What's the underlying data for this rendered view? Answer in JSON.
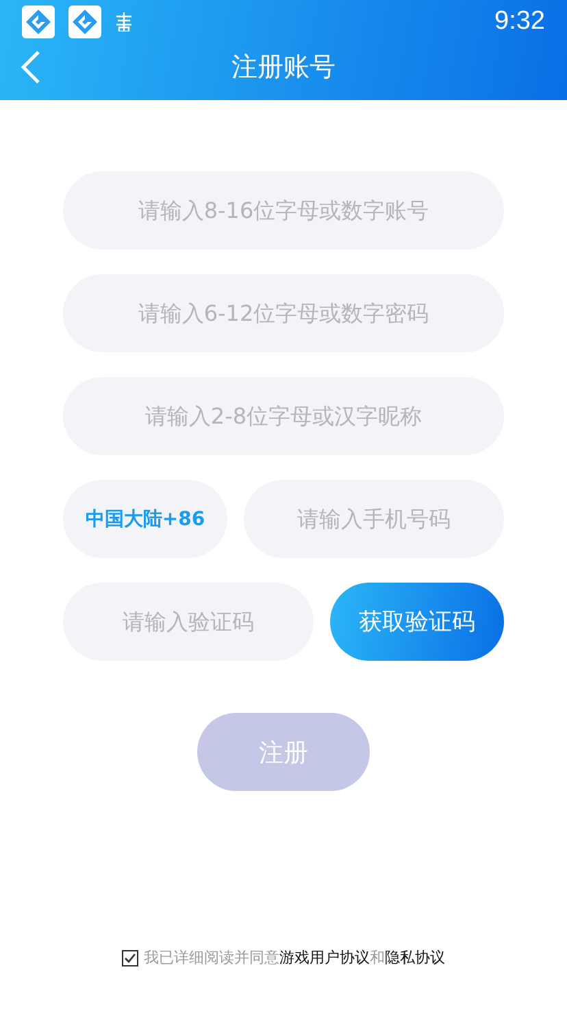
{
  "status_bar": {
    "time": "9:32"
  },
  "header": {
    "title": "注册账号"
  },
  "fields": [
    {
      "placeholder": "请输入8-16位字母或数字账号"
    },
    {
      "placeholder": "请输入6-12位字母或数字密码"
    },
    {
      "placeholder": "请输入2-8位字母或汉字昵称"
    }
  ],
  "phone": {
    "country_code": "中国大陆+86",
    "placeholder": "请输入手机号码"
  },
  "verification": {
    "placeholder": "请输入验证码",
    "button": "获取验证码"
  },
  "register_button": {
    "label": "注册",
    "disabled": true
  },
  "agreement": {
    "checked": true,
    "text": "我已详细阅读并同意",
    "link_1": "游戏用户协议",
    "joiner": "和",
    "link_2": "隐私协议"
  }
}
